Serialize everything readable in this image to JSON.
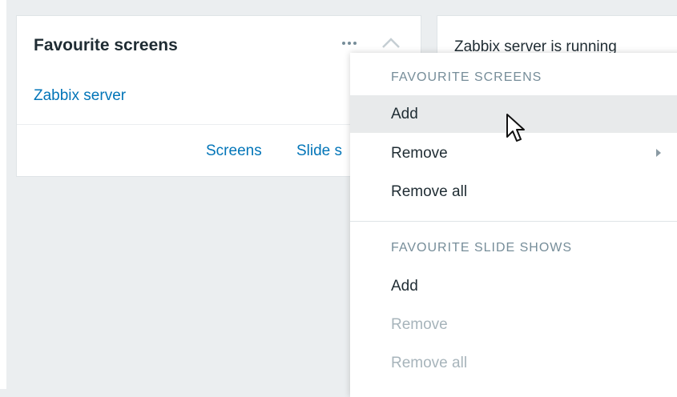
{
  "widget": {
    "title": "Favourite screens",
    "items": [
      "Zabbix server"
    ],
    "footer_links": [
      "Screens",
      "Slide s"
    ],
    "icons": {
      "more": "more-horizontal-icon",
      "collapse": "chevron-up-icon"
    }
  },
  "right_widget": {
    "text": "Zabbix server is running"
  },
  "menu": {
    "sections": [
      {
        "header": "FAVOURITE SCREENS",
        "items": [
          {
            "label": "Add",
            "state": "hover"
          },
          {
            "label": "Remove",
            "state": "normal",
            "has_submenu": true
          },
          {
            "label": "Remove all",
            "state": "normal"
          }
        ]
      },
      {
        "header": "FAVOURITE SLIDE SHOWS",
        "items": [
          {
            "label": "Add",
            "state": "normal"
          },
          {
            "label": "Remove",
            "state": "disabled"
          },
          {
            "label": "Remove all",
            "state": "disabled"
          }
        ]
      }
    ]
  },
  "colors": {
    "link": "#0275b8",
    "text": "#1f2c33",
    "muted": "#768d99",
    "disabled": "#a7b4bb",
    "hover_bg": "#e8eaeb",
    "page_bg": "#ebeef0"
  }
}
